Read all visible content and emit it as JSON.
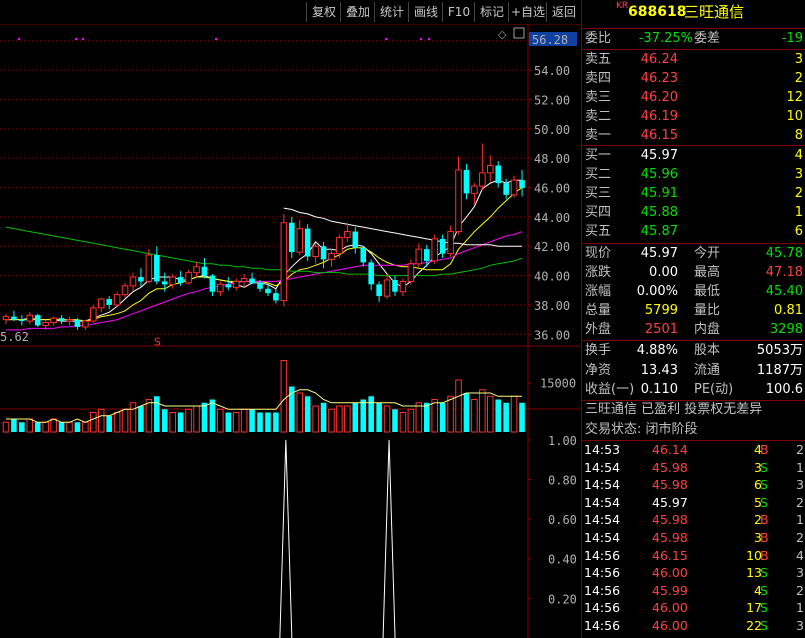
{
  "toolbar": {
    "buttons": [
      "复权",
      "叠加",
      "统计",
      "画线",
      "F10",
      "标记",
      "+自选",
      "返回"
    ]
  },
  "header": {
    "market_badge": "KR",
    "code": "688618",
    "name": "三旺通信"
  },
  "chart_data": {
    "type": "candlestick",
    "price_axis": {
      "ticks": [
        "56.00",
        "54.00",
        "52.00",
        "50.00",
        "48.00",
        "46.00",
        "44.00",
        "42.00",
        "40.00",
        "38.00",
        "36.00"
      ],
      "ylim": [
        35.2,
        56.6
      ]
    },
    "max_label": "56.28",
    "min_label": "5.62",
    "volume_axis": {
      "tick": "15000"
    },
    "indicator_axis": {
      "ticks": [
        "1.00",
        "0.80",
        "0.60",
        "0.40",
        "0.20"
      ],
      "ylim": [
        0,
        1.08
      ]
    },
    "candles": [
      [
        37.0,
        37.4,
        36.7,
        37.2
      ],
      [
        37.2,
        37.6,
        36.9,
        37.0
      ],
      [
        37.0,
        37.3,
        36.6,
        36.9
      ],
      [
        36.9,
        37.5,
        36.7,
        37.3
      ],
      [
        37.3,
        37.4,
        36.5,
        36.6
      ],
      [
        36.6,
        37.0,
        36.3,
        36.8
      ],
      [
        36.8,
        37.2,
        36.6,
        37.1
      ],
      [
        37.1,
        37.3,
        36.7,
        36.9
      ],
      [
        36.9,
        37.2,
        36.6,
        37.0
      ],
      [
        37.0,
        37.1,
        36.3,
        36.5
      ],
      [
        36.5,
        37.0,
        36.3,
        36.9
      ],
      [
        36.9,
        38.0,
        36.8,
        37.8
      ],
      [
        37.8,
        38.5,
        37.5,
        38.4
      ],
      [
        38.4,
        38.6,
        37.7,
        38.0
      ],
      [
        38.0,
        38.9,
        37.9,
        38.7
      ],
      [
        38.7,
        39.5,
        38.5,
        39.3
      ],
      [
        39.3,
        40.2,
        39.0,
        39.9
      ],
      [
        39.9,
        40.5,
        39.2,
        39.6
      ],
      [
        39.6,
        41.8,
        39.5,
        41.4
      ],
      [
        41.4,
        42.0,
        39.4,
        39.6
      ],
      [
        39.6,
        40.2,
        38.9,
        39.4
      ],
      [
        39.4,
        40.1,
        39.1,
        39.9
      ],
      [
        39.9,
        40.3,
        39.3,
        39.5
      ],
      [
        39.5,
        40.4,
        39.4,
        40.2
      ],
      [
        40.2,
        40.9,
        39.9,
        40.6
      ],
      [
        40.6,
        41.2,
        39.8,
        40.0
      ],
      [
        40.0,
        40.1,
        38.6,
        38.9
      ],
      [
        38.9,
        39.6,
        38.6,
        39.4
      ],
      [
        39.4,
        39.9,
        39.0,
        39.2
      ],
      [
        39.2,
        39.8,
        39.0,
        39.6
      ],
      [
        39.6,
        40.1,
        39.2,
        39.8
      ],
      [
        39.8,
        40.2,
        39.4,
        39.5
      ],
      [
        39.5,
        39.7,
        38.9,
        39.1
      ],
      [
        39.1,
        39.4,
        38.6,
        38.8
      ],
      [
        38.8,
        39.1,
        38.1,
        38.3
      ],
      [
        38.3,
        44.2,
        37.9,
        43.6
      ],
      [
        43.6,
        44.0,
        41.2,
        41.6
      ],
      [
        41.6,
        43.8,
        41.4,
        43.2
      ],
      [
        43.2,
        43.5,
        41.0,
        41.3
      ],
      [
        41.3,
        42.2,
        40.8,
        42.0
      ],
      [
        42.0,
        42.3,
        40.5,
        41.1
      ],
      [
        41.1,
        41.8,
        40.6,
        41.5
      ],
      [
        41.5,
        42.8,
        41.2,
        42.6
      ],
      [
        42.6,
        43.6,
        42.3,
        43.0
      ],
      [
        43.0,
        43.3,
        41.5,
        41.9
      ],
      [
        41.9,
        42.0,
        40.6,
        40.9
      ],
      [
        40.9,
        41.1,
        39.0,
        39.4
      ],
      [
        39.4,
        39.6,
        38.2,
        38.6
      ],
      [
        38.6,
        40.1,
        38.4,
        39.7
      ],
      [
        39.7,
        40.0,
        38.6,
        38.9
      ],
      [
        38.9,
        39.8,
        38.6,
        39.6
      ],
      [
        39.6,
        41.1,
        39.4,
        40.8
      ],
      [
        40.8,
        42.2,
        40.6,
        41.8
      ],
      [
        41.8,
        42.1,
        40.6,
        41.0
      ],
      [
        41.0,
        42.8,
        40.8,
        42.5
      ],
      [
        42.5,
        42.8,
        41.2,
        41.5
      ],
      [
        41.5,
        43.4,
        41.3,
        43.0
      ],
      [
        43.0,
        48.1,
        42.8,
        47.2
      ],
      [
        47.2,
        47.6,
        45.2,
        45.6
      ],
      [
        45.6,
        46.3,
        44.8,
        46.1
      ],
      [
        46.1,
        49.0,
        45.8,
        47.0
      ],
      [
        47.0,
        48.2,
        46.4,
        47.5
      ],
      [
        47.5,
        47.8,
        46.0,
        46.3
      ],
      [
        46.3,
        46.6,
        45.2,
        45.5
      ],
      [
        45.5,
        46.8,
        45.3,
        46.5
      ],
      [
        46.5,
        47.2,
        45.4,
        45.97
      ]
    ],
    "ma_lines": [
      {
        "name": "MA5",
        "color": "#ffffff",
        "values": [
          37.0,
          37.0,
          37.0,
          37.1,
          37.0,
          37.0,
          37.0,
          36.9,
          36.9,
          36.9,
          36.9,
          37.1,
          37.3,
          37.5,
          37.9,
          38.4,
          38.9,
          39.2,
          39.7,
          39.9,
          39.9,
          39.9,
          39.7,
          39.7,
          39.9,
          40.0,
          39.8,
          39.7,
          39.6,
          39.4,
          39.2,
          39.5,
          39.5,
          39.4,
          39.1,
          40.0,
          40.6,
          41.1,
          41.5,
          42.3,
          41.8,
          41.8,
          41.7,
          42.0,
          42.1,
          42.0,
          41.5,
          40.8,
          40.1,
          39.5,
          39.2,
          39.6,
          40.2,
          40.7,
          41.3,
          41.6,
          42.0,
          43.3,
          44.0,
          44.7,
          45.9,
          46.3,
          46.5,
          46.3,
          46.5,
          46.5
        ]
      },
      {
        "name": "MA10",
        "color": "#ffff00",
        "values": [
          37.0,
          37.0,
          37.0,
          37.0,
          37.0,
          37.0,
          37.0,
          37.0,
          37.0,
          37.0,
          36.9,
          37.0,
          37.2,
          37.3,
          37.4,
          37.6,
          38.0,
          38.3,
          38.8,
          39.1,
          39.1,
          39.4,
          39.5,
          39.7,
          39.9,
          39.9,
          39.8,
          39.7,
          39.6,
          39.6,
          39.6,
          39.6,
          39.6,
          39.5,
          39.3,
          39.6,
          40.1,
          40.4,
          40.5,
          40.7,
          40.9,
          41.2,
          41.4,
          41.8,
          41.9,
          41.9,
          41.6,
          41.2,
          40.9,
          40.7,
          40.6,
          40.6,
          40.5,
          40.4,
          40.4,
          40.4,
          40.8,
          41.8,
          42.4,
          43.0,
          43.5,
          44.0,
          44.6,
          45.1,
          45.6,
          46.0
        ]
      },
      {
        "name": "MA20",
        "color": "#ff00ff",
        "values": [
          36.3,
          36.3,
          36.3,
          36.4,
          36.4,
          36.4,
          36.4,
          36.5,
          36.5,
          36.6,
          36.6,
          36.7,
          36.8,
          36.9,
          37.0,
          37.2,
          37.4,
          37.6,
          37.8,
          38.0,
          38.2,
          38.4,
          38.6,
          38.8,
          38.9,
          39.1,
          39.2,
          39.3,
          39.4,
          39.5,
          39.6,
          39.6,
          39.6,
          39.6,
          39.6,
          39.7,
          39.8,
          39.9,
          40.0,
          40.1,
          40.2,
          40.3,
          40.4,
          40.5,
          40.6,
          40.7,
          40.7,
          40.7,
          40.7,
          40.7,
          40.7,
          40.8,
          40.8,
          40.9,
          41.0,
          41.1,
          41.2,
          41.5,
          41.7,
          41.9,
          42.1,
          42.3,
          42.5,
          42.7,
          42.8,
          43.0
        ]
      },
      {
        "name": "MA60",
        "color": "#00c000",
        "values": [
          43.3,
          43.2,
          43.1,
          43.0,
          42.9,
          42.8,
          42.7,
          42.6,
          42.5,
          42.4,
          42.3,
          42.2,
          42.1,
          42.0,
          41.9,
          41.8,
          41.7,
          41.6,
          41.5,
          41.4,
          41.3,
          41.2,
          41.1,
          41.0,
          40.9,
          40.8,
          40.8,
          40.7,
          40.7,
          40.6,
          40.6,
          40.5,
          40.5,
          40.4,
          40.4,
          40.4,
          40.3,
          40.3,
          40.3,
          40.2,
          40.2,
          40.2,
          40.2,
          40.1,
          40.1,
          40.1,
          40.1,
          40.0,
          40.0,
          40.0,
          40.0,
          40.0,
          40.0,
          40.0,
          40.0,
          40.1,
          40.1,
          40.2,
          40.3,
          40.4,
          40.5,
          40.7,
          40.8,
          40.9,
          41.0,
          41.2
        ]
      },
      {
        "name": "MA250",
        "color": "#ffffff",
        "values": [
          null,
          null,
          null,
          null,
          null,
          null,
          null,
          null,
          null,
          null,
          null,
          null,
          null,
          null,
          null,
          null,
          null,
          null,
          null,
          null,
          null,
          null,
          null,
          null,
          null,
          null,
          null,
          null,
          null,
          null,
          null,
          null,
          null,
          null,
          null,
          44.6,
          44.5,
          44.3,
          44.2,
          44.0,
          43.9,
          43.7,
          43.6,
          43.5,
          43.4,
          43.3,
          43.2,
          43.1,
          43.0,
          42.9,
          42.8,
          42.7,
          42.6,
          42.5,
          42.4,
          42.3,
          42.2,
          42.2,
          42.1,
          42.1,
          42.1,
          42.1,
          42.0,
          42.0,
          42.0,
          42.0
        ]
      }
    ],
    "volumes": [
      3,
      4,
      3,
      4,
      3,
      3,
      4,
      3,
      3,
      3,
      3,
      6,
      7,
      5,
      6,
      7,
      9,
      8,
      10,
      11,
      7,
      6,
      6,
      7,
      8,
      9,
      10,
      7,
      6,
      6,
      7,
      7,
      6,
      6,
      6,
      22,
      14,
      12,
      11,
      8,
      9,
      7,
      8,
      8,
      9,
      10,
      11,
      9,
      8,
      7,
      6,
      7,
      9,
      9,
      10,
      9,
      11,
      16,
      12,
      10,
      13,
      11,
      10,
      9,
      11,
      9
    ],
    "volume_ma": [
      4,
      4,
      4,
      4,
      3,
      3,
      4,
      3,
      3,
      4,
      3,
      4,
      5,
      5,
      6,
      7,
      7,
      8,
      9,
      9,
      8,
      8,
      8,
      8,
      8,
      8,
      9,
      8,
      7,
      7,
      7,
      7,
      7,
      7,
      7,
      10,
      12,
      13,
      13,
      12,
      10,
      9,
      9,
      9,
      9,
      9,
      9,
      9,
      9,
      9,
      8,
      8,
      8,
      8,
      9,
      9,
      10,
      11,
      12,
      12,
      12,
      12,
      11,
      11,
      11,
      11
    ],
    "indicator_peaks": [
      {
        "index": 35,
        "value": 1.0
      },
      {
        "index": 48,
        "value": 1.0
      }
    ],
    "markers": {
      "s_label": "S"
    }
  },
  "quote": {
    "weibi_label": "委比",
    "weibi_value": "-37.25%",
    "weicha_label": "委差",
    "weicha_value": "-19",
    "asks": [
      {
        "label": "卖五",
        "price": "46.24",
        "vol": "3"
      },
      {
        "label": "卖四",
        "price": "46.23",
        "vol": "2"
      },
      {
        "label": "卖三",
        "price": "46.20",
        "vol": "12"
      },
      {
        "label": "卖二",
        "price": "46.19",
        "vol": "10"
      },
      {
        "label": "卖一",
        "price": "46.15",
        "vol": "8"
      }
    ],
    "bids": [
      {
        "label": "买一",
        "price": "45.97",
        "vol": "4"
      },
      {
        "label": "买二",
        "price": "45.96",
        "vol": "3"
      },
      {
        "label": "买三",
        "price": "45.91",
        "vol": "2"
      },
      {
        "label": "买四",
        "price": "45.88",
        "vol": "1"
      },
      {
        "label": "买五",
        "price": "45.87",
        "vol": "6"
      }
    ],
    "stats": [
      {
        "l1": "现价",
        "v1": "45.97",
        "c1": "white",
        "l2": "今开",
        "v2": "45.78",
        "c2": "green"
      },
      {
        "l1": "涨跌",
        "v1": "0.00",
        "c1": "white",
        "l2": "最高",
        "v2": "47.18",
        "c2": "red"
      },
      {
        "l1": "涨幅",
        "v1": "0.00%",
        "c1": "white",
        "l2": "最低",
        "v2": "45.40",
        "c2": "green"
      },
      {
        "l1": "总量",
        "v1": "5799",
        "c1": "yellow",
        "l2": "量比",
        "v2": "0.81",
        "c2": "yellow"
      },
      {
        "l1": "外盘",
        "v1": "2501",
        "c1": "red",
        "l2": "内盘",
        "v2": "3298",
        "c2": "green"
      }
    ],
    "fundamentals": [
      {
        "l1": "换手",
        "v1": "4.88%",
        "l2": "股本",
        "v2": "5053万"
      },
      {
        "l1": "净资",
        "v1": "13.43",
        "l2": "流通",
        "v2": "1187万"
      },
      {
        "l1": "收益(一)",
        "v1": "0.110",
        "l2": "PE(动)",
        "v2": "100.6"
      }
    ],
    "info_line1": "三旺通信 已盈利 投票权无差异",
    "info_line2": "交易状态: 闭市阶段"
  },
  "ticks": [
    {
      "time": "14:53",
      "price": "46.14",
      "pc": "red",
      "vol": "4",
      "side": "B",
      "n": "2"
    },
    {
      "time": "14:54",
      "price": "45.98",
      "pc": "red",
      "vol": "3",
      "side": "S",
      "n": "1"
    },
    {
      "time": "14:54",
      "price": "45.98",
      "pc": "red",
      "vol": "6",
      "side": "S",
      "n": "3"
    },
    {
      "time": "14:54",
      "price": "45.97",
      "pc": "white",
      "vol": "5",
      "side": "S",
      "n": "2"
    },
    {
      "time": "14:54",
      "price": "45.98",
      "pc": "red",
      "vol": "2",
      "side": "B",
      "n": "1"
    },
    {
      "time": "14:54",
      "price": "45.98",
      "pc": "red",
      "vol": "3",
      "side": "B",
      "n": "2"
    },
    {
      "time": "14:56",
      "price": "46.15",
      "pc": "red",
      "vol": "10",
      "side": "B",
      "n": "4"
    },
    {
      "time": "14:56",
      "price": "46.00",
      "pc": "red",
      "vol": "13",
      "side": "S",
      "n": "3"
    },
    {
      "time": "14:56",
      "price": "45.99",
      "pc": "red",
      "vol": "4",
      "side": "S",
      "n": "2"
    },
    {
      "time": "14:56",
      "price": "46.00",
      "pc": "red",
      "vol": "17",
      "side": "S",
      "n": "1"
    },
    {
      "time": "14:56",
      "price": "46.00",
      "pc": "red",
      "vol": "22",
      "side": "S",
      "n": "3"
    }
  ]
}
